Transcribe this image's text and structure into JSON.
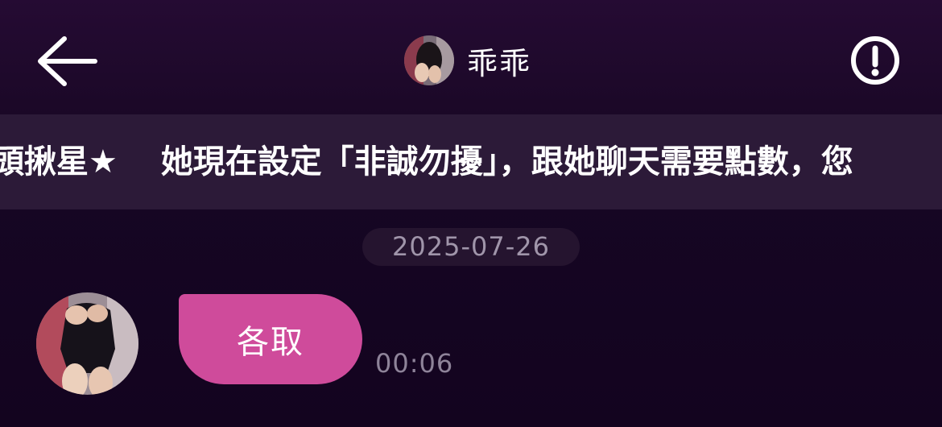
{
  "header": {
    "title": "乖乖",
    "back_icon": "arrow-left-icon",
    "info_icon": "exclamation-circle-icon"
  },
  "announcement": {
    "text": "頭揪星★　 她現在設定「非誠勿擾」，跟她聊天需要點數，您"
  },
  "chat": {
    "date": "2025-07-26",
    "messages": [
      {
        "sender": "other",
        "text": "各取",
        "time": "00:06"
      }
    ]
  },
  "colors": {
    "background": "#160624",
    "header": "#250b33",
    "marquee": "#2c1a38",
    "bubble": "#cf4b9b",
    "date_pill": "#25142f",
    "muted_text": "#8e8399"
  }
}
